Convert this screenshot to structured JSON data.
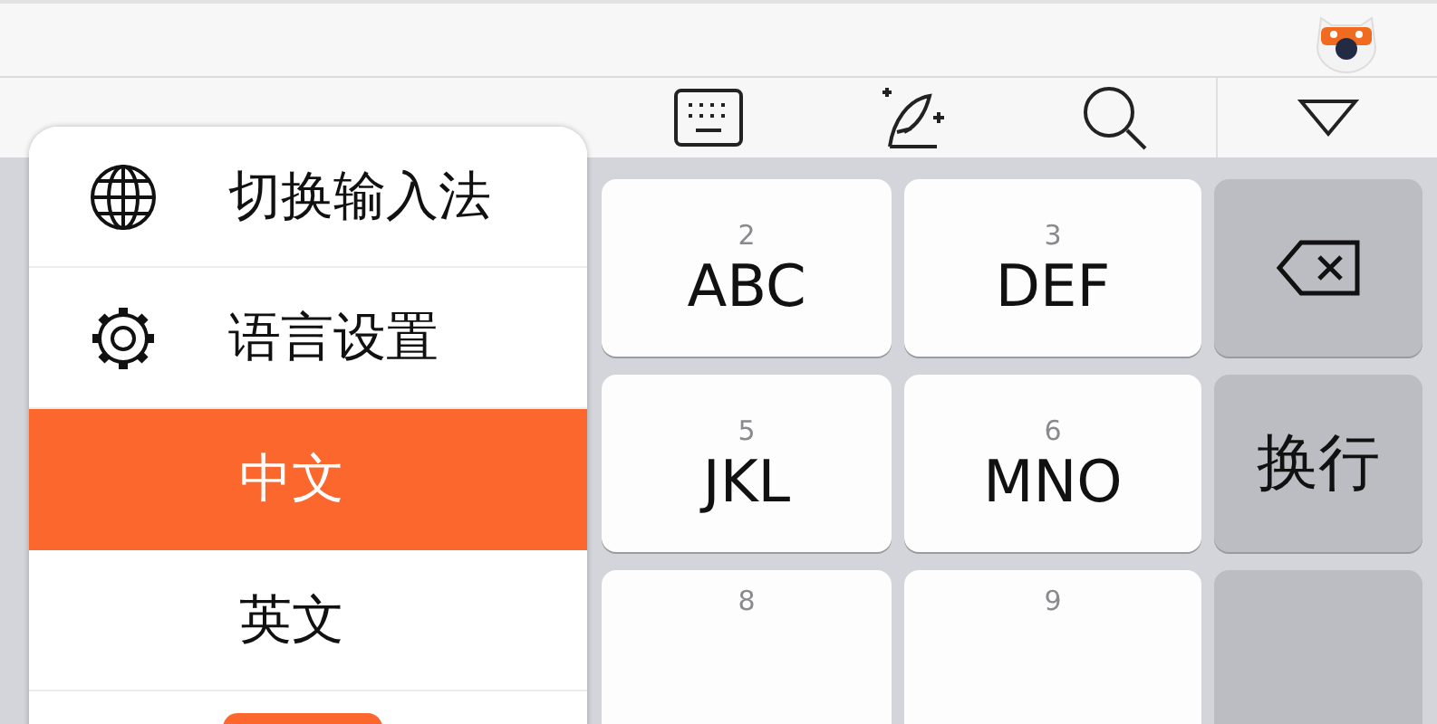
{
  "menu": {
    "items": [
      {
        "kind": "switch",
        "label": "切换输入法"
      },
      {
        "kind": "settings",
        "label": "语言设置"
      },
      {
        "kind": "option",
        "label": "中文",
        "selected": true
      },
      {
        "kind": "option",
        "label": "英文",
        "selected": false
      }
    ]
  },
  "keys": [
    {
      "kind": "letter",
      "number": "2",
      "label": "ABC"
    },
    {
      "kind": "letter",
      "number": "3",
      "label": "DEF"
    },
    {
      "kind": "backspace"
    },
    {
      "kind": "letter",
      "number": "5",
      "label": "JKL"
    },
    {
      "kind": "letter",
      "number": "6",
      "label": "MNO"
    },
    {
      "kind": "function",
      "label": "换行"
    },
    {
      "kind": "letter",
      "number": "8"
    },
    {
      "kind": "letter",
      "number": "9"
    },
    {
      "kind": "function"
    }
  ]
}
